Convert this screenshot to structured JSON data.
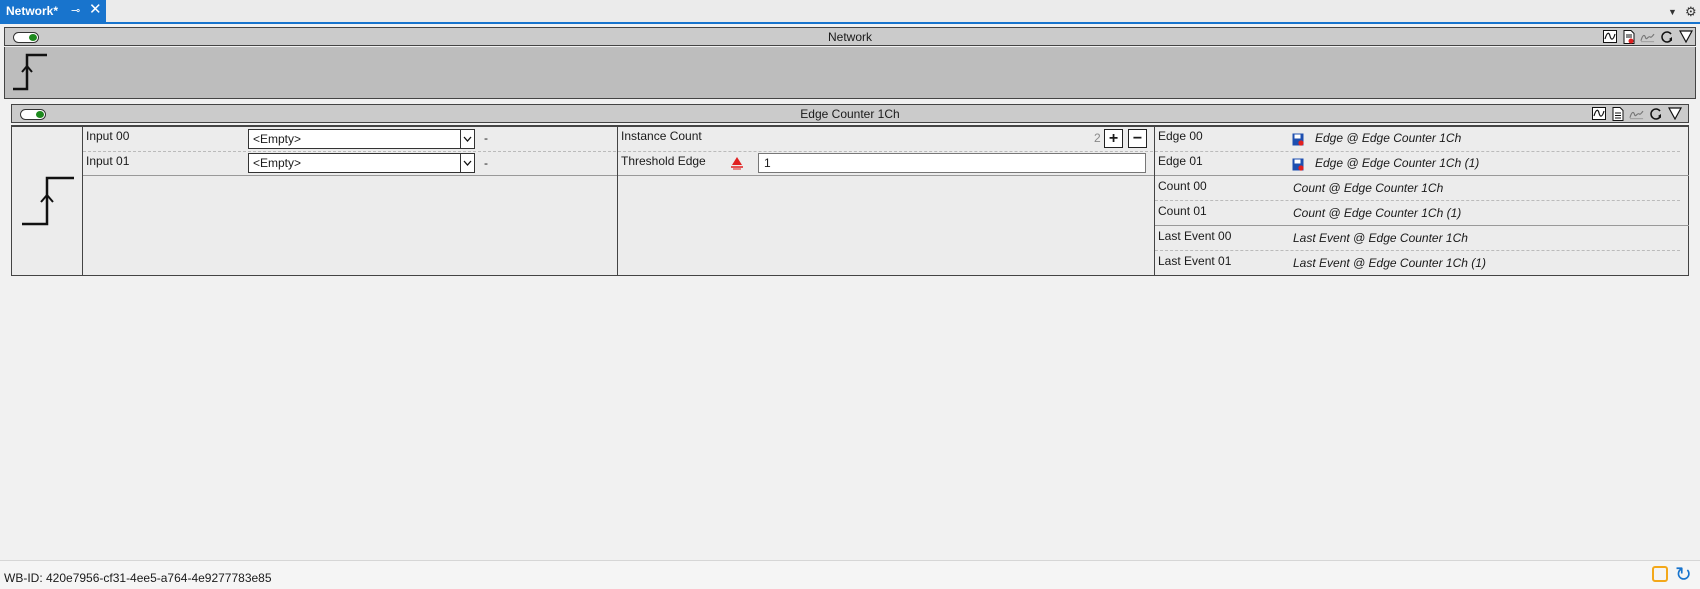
{
  "tab": {
    "title": "Network*",
    "pin": "⊸",
    "close": "✕"
  },
  "strip": {
    "dropdown": "▼",
    "settings": "⚙"
  },
  "network": {
    "title": "Network"
  },
  "block": {
    "title": "Edge Counter 1Ch",
    "inputs": [
      {
        "label": "Input 00",
        "value": "<Empty>",
        "suffix": "-"
      },
      {
        "label": "Input 01",
        "value": "<Empty>",
        "suffix": "-"
      }
    ],
    "params": {
      "instance_count_label": "Instance Count",
      "instance_count_value": "2",
      "plus": "+",
      "minus": "−",
      "threshold_label": "Threshold Edge",
      "threshold_value": "1"
    },
    "outputs": [
      {
        "label": "Edge 00",
        "value": "Edge @ Edge Counter 1Ch"
      },
      {
        "label": "Edge 01",
        "value": "Edge @ Edge Counter 1Ch (1)"
      },
      {
        "label": "Count 00",
        "value": "Count @ Edge Counter 1Ch"
      },
      {
        "label": "Count 01",
        "value": "Count @ Edge Counter 1Ch (1)"
      },
      {
        "label": "Last Event 00",
        "value": "Last Event @ Edge Counter 1Ch"
      },
      {
        "label": "Last Event 01",
        "value": "Last Event @ Edge Counter 1Ch (1)"
      }
    ]
  },
  "status": {
    "wb_id": "WB-ID: 420e7956-cf31-4ee5-a764-4e9277783e85"
  },
  "colors": {
    "accent": "#1874cd",
    "toggle_on": "#1e8a1e",
    "warning": "#f3a81a",
    "alert": "#e02020"
  }
}
